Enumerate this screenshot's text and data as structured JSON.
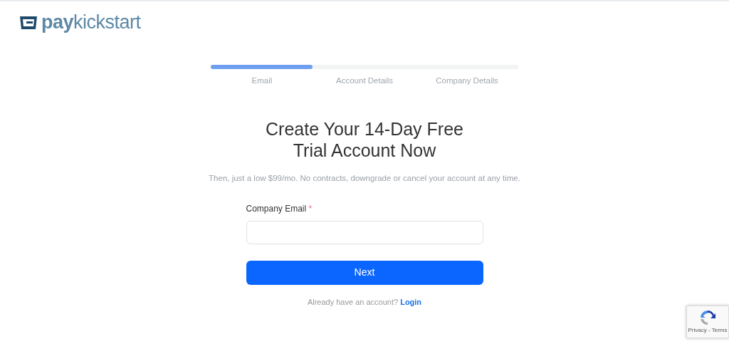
{
  "logo": {
    "text": "**pay**kickstart"
  },
  "progress": {
    "level": 0.33,
    "steps": [
      "Email",
      "Account Details",
      "Company Details"
    ]
  },
  "heading": [
    "Create Your 14-Day Free",
    "Trial Account Now"
  ],
  "subtitle": "Then, just a low $99/mo. No contracts, downgrade or cancel your account at any time.",
  "field": {
    "label": "Company Email",
    "required_mark": "*"
  },
  "submit": "Next",
  "login": {
    "prompt": "Already have an account?",
    "link": "Login"
  },
  "recaptcha": {
    "links": "Privacy - Terms"
  }
}
